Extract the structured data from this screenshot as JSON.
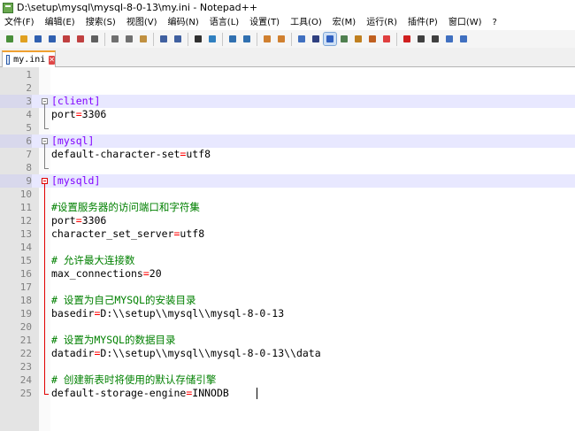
{
  "window": {
    "title": "D:\\setup\\mysql\\mysql-8-0-13\\my.ini - Notepad++"
  },
  "menu": [
    "文件(F)",
    "编辑(E)",
    "搜索(S)",
    "视图(V)",
    "编码(N)",
    "语言(L)",
    "设置(T)",
    "工具(O)",
    "宏(M)",
    "运行(R)",
    "插件(P)",
    "窗口(W)",
    "?"
  ],
  "toolbar": {
    "icons": [
      "new-file-icon",
      "open-file-icon",
      "save-icon",
      "save-all-icon",
      "close-icon",
      "close-all-icon",
      "print-icon",
      "cut-icon",
      "copy-icon",
      "paste-icon",
      "undo-icon",
      "redo-icon",
      "find-icon",
      "replace-icon",
      "zoom-in-icon",
      "zoom-out-icon",
      "sync-vertical-icon",
      "sync-horizontal-icon",
      "word-wrap-icon",
      "show-all-chars-icon",
      "indent-guide-icon",
      "document-map-icon",
      "function-list-icon",
      "folder-workspace-icon",
      "monitor-icon",
      "record-macro-icon",
      "stop-record-icon",
      "play-macro-icon",
      "run-multiple-icon",
      "save-macro-icon"
    ]
  },
  "tab": {
    "label": "my.ini"
  },
  "colors": {
    "section": "#8000ff",
    "operator": "#ff0000",
    "comment": "#008000",
    "band": "#e8e8ff"
  },
  "editor": {
    "lines": [
      {
        "num": "1",
        "text": ""
      },
      {
        "num": "2",
        "text": ""
      },
      {
        "num": "3",
        "text": "[client]",
        "type": "section"
      },
      {
        "num": "4",
        "key": "port",
        "value": "3306",
        "type": "kv"
      },
      {
        "num": "5",
        "text": ""
      },
      {
        "num": "6",
        "text": "[mysql]",
        "type": "section"
      },
      {
        "num": "7",
        "key": "default-character-set",
        "value": "utf8",
        "type": "kv"
      },
      {
        "num": "8",
        "text": ""
      },
      {
        "num": "9",
        "text": "[mysqld]",
        "type": "section"
      },
      {
        "num": "10",
        "text": ""
      },
      {
        "num": "11",
        "text": "#设置服务器的访问端口和字符集",
        "type": "comment"
      },
      {
        "num": "12",
        "key": "port",
        "value": "3306",
        "type": "kv"
      },
      {
        "num": "13",
        "key": "character_set_server",
        "value": "utf8",
        "type": "kv"
      },
      {
        "num": "14",
        "text": ""
      },
      {
        "num": "15",
        "text": "# 允许最大连接数",
        "type": "comment"
      },
      {
        "num": "16",
        "key": "max_connections",
        "value": "20",
        "type": "kv"
      },
      {
        "num": "17",
        "text": ""
      },
      {
        "num": "18",
        "text": "# 设置为自己MYSQL的安装目录",
        "type": "comment"
      },
      {
        "num": "19",
        "key": "basedir",
        "value": "D:\\\\setup\\\\mysql\\\\mysql-8-0-13",
        "type": "kv"
      },
      {
        "num": "20",
        "text": ""
      },
      {
        "num": "21",
        "text": "# 设置为MYSQL的数据目录",
        "type": "comment"
      },
      {
        "num": "22",
        "key": "datadir",
        "value": "D:\\\\setup\\\\mysql\\\\mysql-8-0-13\\\\data",
        "type": "kv"
      },
      {
        "num": "23",
        "text": ""
      },
      {
        "num": "24",
        "text": "# 创建新表时将使用的默认存储引擎",
        "type": "comment"
      },
      {
        "num": "25",
        "key": "default-storage-engine",
        "value": "INNODB",
        "type": "kv"
      }
    ]
  }
}
